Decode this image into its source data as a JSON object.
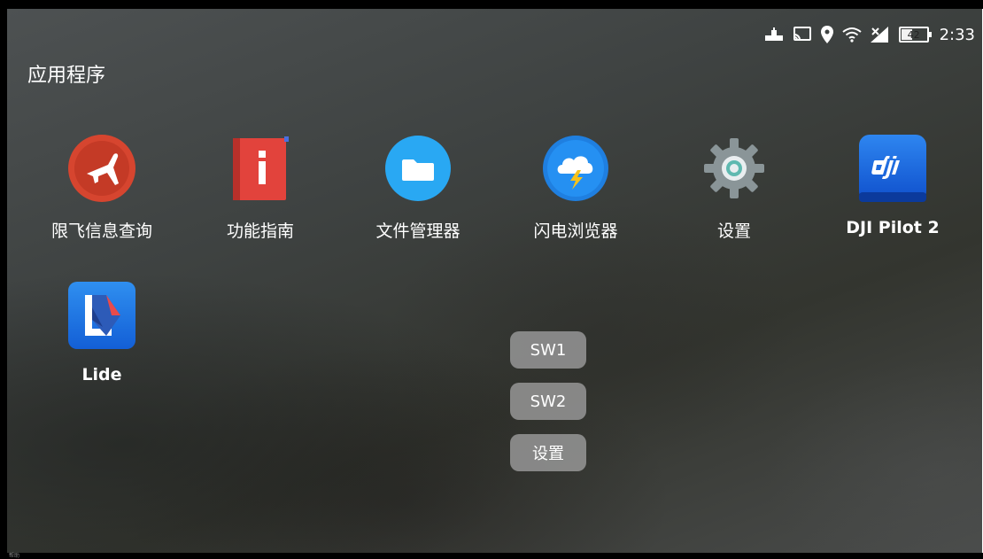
{
  "status_bar": {
    "battery_level": "42",
    "time": "2:33",
    "icons": [
      "usb-icon",
      "cast-icon",
      "location-icon",
      "wifi-icon",
      "signal-icon",
      "battery-icon"
    ]
  },
  "section_title": "应用程序",
  "apps": [
    {
      "label": "限飞信息查询",
      "icon": "airplane-icon",
      "color": "#d6452f"
    },
    {
      "label": "功能指南",
      "icon": "info-book-icon",
      "color": "#e2433c"
    },
    {
      "label": "文件管理器",
      "icon": "folder-icon",
      "color": "#29a8f3"
    },
    {
      "label": "闪电浏览器",
      "icon": "lightning-cloud-icon",
      "color": "#1f7fe0"
    },
    {
      "label": "设置",
      "icon": "gear-icon",
      "color": "#8a9598"
    },
    {
      "label": "DJI Pilot 2",
      "icon": "dji-logo-icon",
      "color": "#1466e6"
    },
    {
      "label": "Lide",
      "icon": "lide-logo-icon",
      "color": "#1a73e8"
    }
  ],
  "quick_buttons": {
    "sw1": "SW1",
    "sw2": "SW2",
    "settings": "设置"
  },
  "bottom_note": "帮助"
}
